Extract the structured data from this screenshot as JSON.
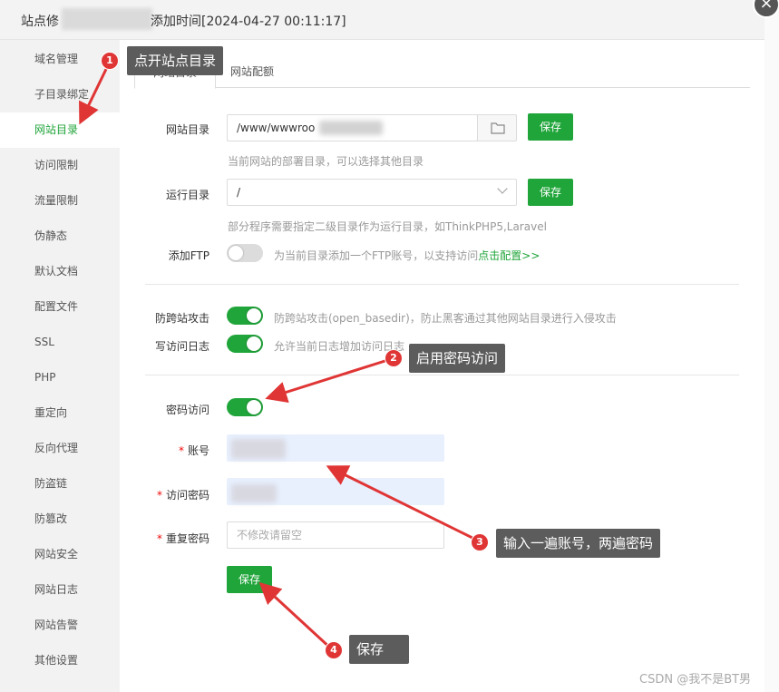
{
  "dialog": {
    "title_prefix": "站点修",
    "title_suffix": "添加时间[2024-04-27 00:11:17]",
    "close_symbol": "×"
  },
  "sidebar": {
    "items": [
      {
        "label": "域名管理"
      },
      {
        "label": "子目录绑定"
      },
      {
        "label": "网站目录",
        "active": true
      },
      {
        "label": "访问限制"
      },
      {
        "label": "流量限制"
      },
      {
        "label": "伪静态"
      },
      {
        "label": "默认文档"
      },
      {
        "label": "配置文件"
      },
      {
        "label": "SSL"
      },
      {
        "label": "PHP"
      },
      {
        "label": "重定向"
      },
      {
        "label": "反向代理"
      },
      {
        "label": "防盗链"
      },
      {
        "label": "防篡改"
      },
      {
        "label": "网站安全"
      },
      {
        "label": "网站日志"
      },
      {
        "label": "网站告警"
      },
      {
        "label": "其他设置"
      }
    ]
  },
  "tabs": [
    {
      "label": "网站目录",
      "active": true
    },
    {
      "label": "网站配额"
    }
  ],
  "form": {
    "site_dir_label": "网站目录",
    "site_dir_value": "/www/wwwroo",
    "site_dir_save": "保存",
    "site_dir_hint": "当前网站的部署目录，可以选择其他目录",
    "run_dir_label": "运行目录",
    "run_dir_value": "/",
    "run_dir_save": "保存",
    "run_dir_hint": "部分程序需要指定二级目录作为运行目录，如ThinkPHP5,Laravel",
    "ftp_label": "添加FTP",
    "ftp_hint": "为当前目录添加一个FTP账号，以支持访问",
    "ftp_link": "点击配置>>",
    "ftp_enabled": false,
    "cross_site_label": "防跨站攻击",
    "cross_site_hint": "防跨站攻击(open_basedir)，防止黑客通过其他网站目录进行入侵攻击",
    "cross_site_enabled": true,
    "access_log_label": "写访问日志",
    "access_log_hint": "允许当前日志增加访问日志",
    "access_log_enabled": true,
    "password_access_label": "密码访问",
    "password_access_enabled": true,
    "required_mark": "*",
    "account_label": "账号",
    "password_label": "访问密码",
    "repeat_password_label": "重复密码",
    "repeat_password_placeholder": "不修改请留空",
    "save_button": "保存"
  },
  "annotations": [
    {
      "number": "1",
      "text": "点开站点目录"
    },
    {
      "number": "2",
      "text": "启用密码访问"
    },
    {
      "number": "3",
      "text": "输入一遍账号，两遍密码"
    },
    {
      "number": "4",
      "text": "保存"
    }
  ],
  "watermark": "CSDN @我不是BT男",
  "colors": {
    "accent": "#20a53a",
    "annotation_red": "#e03535",
    "callout_bg": "#5c5c5c"
  }
}
